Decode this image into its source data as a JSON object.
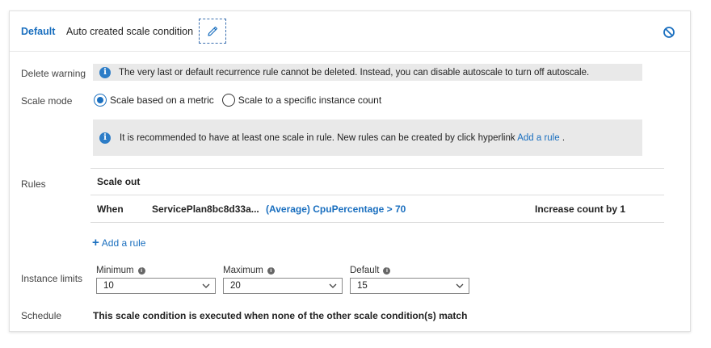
{
  "header": {
    "default_label": "Default",
    "condition_name": "Auto created scale condition",
    "edit_icon": "pencil-icon",
    "disable_icon": "disable-circle-icon"
  },
  "delete_warning": {
    "label": "Delete warning",
    "message": "The very last or default recurrence rule cannot be deleted. Instead, you can disable autoscale to turn off autoscale."
  },
  "scale_mode": {
    "label": "Scale mode",
    "options": [
      {
        "label": "Scale based on a metric",
        "selected": true
      },
      {
        "label": "Scale to a specific instance count",
        "selected": false
      }
    ]
  },
  "recommendation": {
    "message": "It is recommended to have at least one scale in rule. New rules can be created by click hyperlink",
    "link": "Add a rule",
    "suffix": "."
  },
  "rules": {
    "label": "Rules",
    "header": "Scale out",
    "rows": [
      {
        "when": "When",
        "resource": "ServicePlan8bc8d33a...",
        "metric": "(Average) CpuPercentage > 70",
        "action": "Increase count by 1"
      }
    ],
    "add_rule": "Add a rule"
  },
  "instance_limits": {
    "label": "Instance limits",
    "minimum": {
      "label": "Minimum",
      "value": "10"
    },
    "maximum": {
      "label": "Maximum",
      "value": "20"
    },
    "default": {
      "label": "Default",
      "value": "15"
    }
  },
  "schedule": {
    "label": "Schedule",
    "text": "This scale condition is executed when none of the other scale condition(s) match"
  },
  "colors": {
    "accent": "#1a6fbf",
    "info_bar": "#e9e9e9",
    "border": "#dddddd"
  }
}
